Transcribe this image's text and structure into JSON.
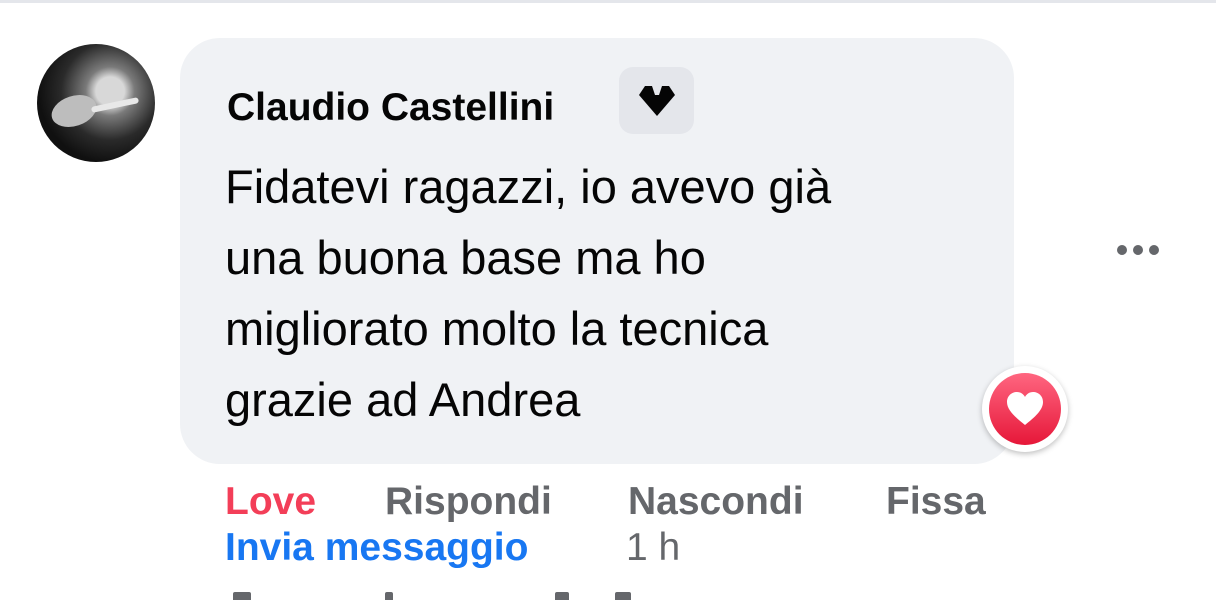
{
  "comment": {
    "author": "Claudio Castellini",
    "text_lines": [
      "Fidatevi ragazzi, io avevo già",
      "una buona base ma ho",
      "migliorato molto la tecnica",
      "grazie ad Andrea"
    ],
    "reaction_icon": "heart-icon"
  },
  "actions": {
    "love": "Love",
    "reply": "Rispondi",
    "hide": "Nascondi",
    "pin": "Fissa",
    "send_message": "Invia messaggio",
    "time": "1 h"
  },
  "colors": {
    "love": "#f33e58",
    "link": "#1877f2",
    "secondary": "#65676b",
    "bubble": "#f0f2f5"
  }
}
